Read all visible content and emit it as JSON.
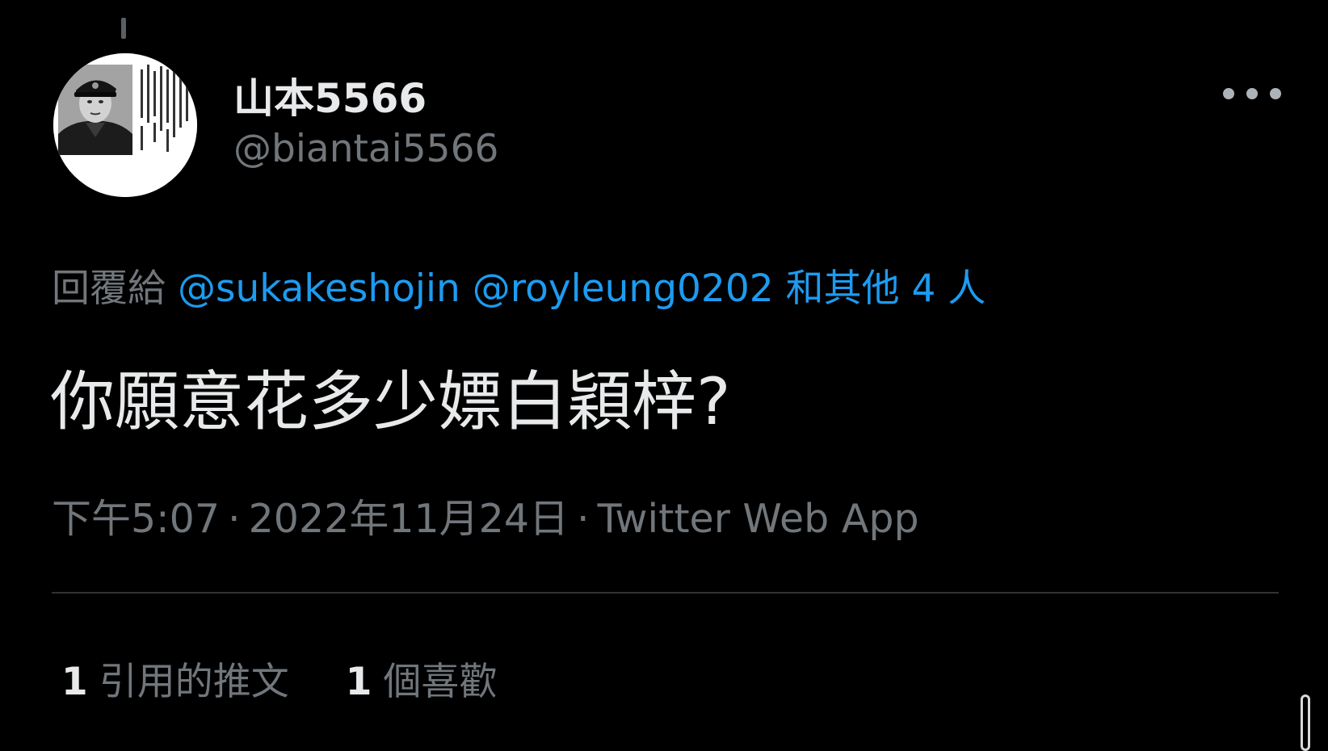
{
  "tweet": {
    "author": {
      "display_name": "山本5566",
      "handle": "@biantai5566",
      "avatar_icon": "avatar-photo-icon"
    },
    "more_icon": "more-horizontal-icon",
    "reply": {
      "prefix": "回覆給",
      "mention_1": "@sukakeshojin",
      "mention_2": "@royleung0202",
      "others": "和其他 4 人"
    },
    "text": "你願意花多少嫖白穎梓?",
    "meta": {
      "time": "下午5:07",
      "date": "2022年11月24日",
      "source": "Twitter Web App",
      "separator": "·"
    },
    "stats": {
      "quotes_count": "1",
      "quotes_label": "引用的推文",
      "likes_count": "1",
      "likes_label": "個喜歡"
    }
  },
  "colors": {
    "background": "#000000",
    "primary_text": "#e7e9ea",
    "secondary_text": "#71767b",
    "link": "#1d9bf0",
    "divider": "#2f3336"
  }
}
